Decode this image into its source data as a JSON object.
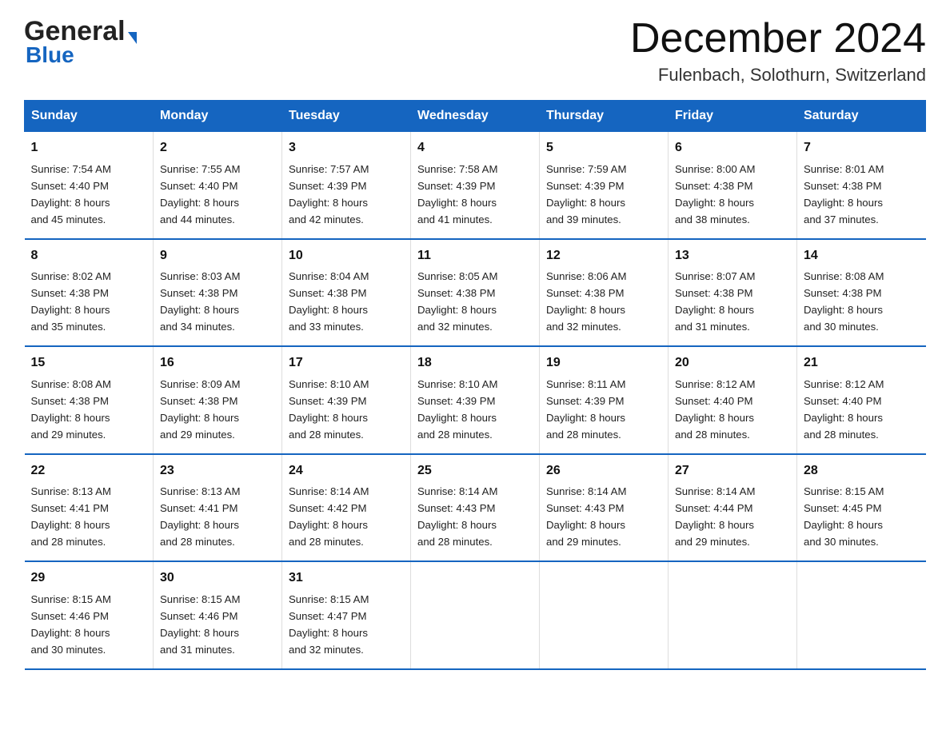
{
  "logo": {
    "line1": "General",
    "line2": "Blue"
  },
  "title": "December 2024",
  "subtitle": "Fulenbach, Solothurn, Switzerland",
  "days_of_week": [
    "Sunday",
    "Monday",
    "Tuesday",
    "Wednesday",
    "Thursday",
    "Friday",
    "Saturday"
  ],
  "weeks": [
    [
      {
        "day": "1",
        "sunrise": "7:54 AM",
        "sunset": "4:40 PM",
        "daylight": "8 hours and 45 minutes."
      },
      {
        "day": "2",
        "sunrise": "7:55 AM",
        "sunset": "4:40 PM",
        "daylight": "8 hours and 44 minutes."
      },
      {
        "day": "3",
        "sunrise": "7:57 AM",
        "sunset": "4:39 PM",
        "daylight": "8 hours and 42 minutes."
      },
      {
        "day": "4",
        "sunrise": "7:58 AM",
        "sunset": "4:39 PM",
        "daylight": "8 hours and 41 minutes."
      },
      {
        "day": "5",
        "sunrise": "7:59 AM",
        "sunset": "4:39 PM",
        "daylight": "8 hours and 39 minutes."
      },
      {
        "day": "6",
        "sunrise": "8:00 AM",
        "sunset": "4:38 PM",
        "daylight": "8 hours and 38 minutes."
      },
      {
        "day": "7",
        "sunrise": "8:01 AM",
        "sunset": "4:38 PM",
        "daylight": "8 hours and 37 minutes."
      }
    ],
    [
      {
        "day": "8",
        "sunrise": "8:02 AM",
        "sunset": "4:38 PM",
        "daylight": "8 hours and 35 minutes."
      },
      {
        "day": "9",
        "sunrise": "8:03 AM",
        "sunset": "4:38 PM",
        "daylight": "8 hours and 34 minutes."
      },
      {
        "day": "10",
        "sunrise": "8:04 AM",
        "sunset": "4:38 PM",
        "daylight": "8 hours and 33 minutes."
      },
      {
        "day": "11",
        "sunrise": "8:05 AM",
        "sunset": "4:38 PM",
        "daylight": "8 hours and 32 minutes."
      },
      {
        "day": "12",
        "sunrise": "8:06 AM",
        "sunset": "4:38 PM",
        "daylight": "8 hours and 32 minutes."
      },
      {
        "day": "13",
        "sunrise": "8:07 AM",
        "sunset": "4:38 PM",
        "daylight": "8 hours and 31 minutes."
      },
      {
        "day": "14",
        "sunrise": "8:08 AM",
        "sunset": "4:38 PM",
        "daylight": "8 hours and 30 minutes."
      }
    ],
    [
      {
        "day": "15",
        "sunrise": "8:08 AM",
        "sunset": "4:38 PM",
        "daylight": "8 hours and 29 minutes."
      },
      {
        "day": "16",
        "sunrise": "8:09 AM",
        "sunset": "4:38 PM",
        "daylight": "8 hours and 29 minutes."
      },
      {
        "day": "17",
        "sunrise": "8:10 AM",
        "sunset": "4:39 PM",
        "daylight": "8 hours and 28 minutes."
      },
      {
        "day": "18",
        "sunrise": "8:10 AM",
        "sunset": "4:39 PM",
        "daylight": "8 hours and 28 minutes."
      },
      {
        "day": "19",
        "sunrise": "8:11 AM",
        "sunset": "4:39 PM",
        "daylight": "8 hours and 28 minutes."
      },
      {
        "day": "20",
        "sunrise": "8:12 AM",
        "sunset": "4:40 PM",
        "daylight": "8 hours and 28 minutes."
      },
      {
        "day": "21",
        "sunrise": "8:12 AM",
        "sunset": "4:40 PM",
        "daylight": "8 hours and 28 minutes."
      }
    ],
    [
      {
        "day": "22",
        "sunrise": "8:13 AM",
        "sunset": "4:41 PM",
        "daylight": "8 hours and 28 minutes."
      },
      {
        "day": "23",
        "sunrise": "8:13 AM",
        "sunset": "4:41 PM",
        "daylight": "8 hours and 28 minutes."
      },
      {
        "day": "24",
        "sunrise": "8:14 AM",
        "sunset": "4:42 PM",
        "daylight": "8 hours and 28 minutes."
      },
      {
        "day": "25",
        "sunrise": "8:14 AM",
        "sunset": "4:43 PM",
        "daylight": "8 hours and 28 minutes."
      },
      {
        "day": "26",
        "sunrise": "8:14 AM",
        "sunset": "4:43 PM",
        "daylight": "8 hours and 29 minutes."
      },
      {
        "day": "27",
        "sunrise": "8:14 AM",
        "sunset": "4:44 PM",
        "daylight": "8 hours and 29 minutes."
      },
      {
        "day": "28",
        "sunrise": "8:15 AM",
        "sunset": "4:45 PM",
        "daylight": "8 hours and 30 minutes."
      }
    ],
    [
      {
        "day": "29",
        "sunrise": "8:15 AM",
        "sunset": "4:46 PM",
        "daylight": "8 hours and 30 minutes."
      },
      {
        "day": "30",
        "sunrise": "8:15 AM",
        "sunset": "4:46 PM",
        "daylight": "8 hours and 31 minutes."
      },
      {
        "day": "31",
        "sunrise": "8:15 AM",
        "sunset": "4:47 PM",
        "daylight": "8 hours and 32 minutes."
      },
      null,
      null,
      null,
      null
    ]
  ],
  "labels": {
    "sunrise": "Sunrise:",
    "sunset": "Sunset:",
    "daylight": "Daylight:"
  }
}
